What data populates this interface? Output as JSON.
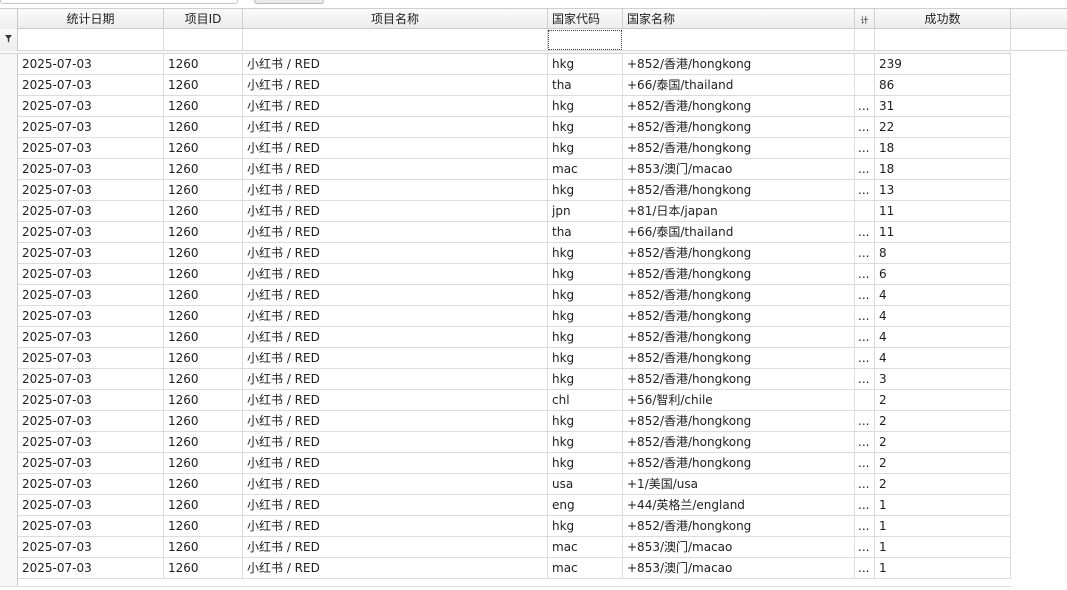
{
  "columns": [
    {
      "key": "date",
      "label": "统计日期"
    },
    {
      "key": "project_id",
      "label": "项目ID"
    },
    {
      "key": "project_name",
      "label": "项目名称"
    },
    {
      "key": "country_code",
      "label": "国家代码"
    },
    {
      "key": "country_name",
      "label": "国家名称"
    },
    {
      "key": "extra",
      "label": "计"
    },
    {
      "key": "success_count",
      "label": "成功数"
    }
  ],
  "filter_icon": "filter-funnel-icon",
  "rows": [
    {
      "date": "2025-07-03",
      "project_id": "1260",
      "project_name": "小红书 / RED",
      "country_code": "hkg",
      "country_name": "+852/香港/hongkong",
      "extra": "",
      "success_count": "239"
    },
    {
      "date": "2025-07-03",
      "project_id": "1260",
      "project_name": "小红书 / RED",
      "country_code": "tha",
      "country_name": "+66/泰国/thailand",
      "extra": "",
      "success_count": "86"
    },
    {
      "date": "2025-07-03",
      "project_id": "1260",
      "project_name": "小红书 / RED",
      "country_code": "hkg",
      "country_name": "+852/香港/hongkong",
      "extra": "...",
      "success_count": "31"
    },
    {
      "date": "2025-07-03",
      "project_id": "1260",
      "project_name": "小红书 / RED",
      "country_code": "hkg",
      "country_name": "+852/香港/hongkong",
      "extra": "...",
      "success_count": "22"
    },
    {
      "date": "2025-07-03",
      "project_id": "1260",
      "project_name": "小红书 / RED",
      "country_code": "hkg",
      "country_name": "+852/香港/hongkong",
      "extra": "...",
      "success_count": "18"
    },
    {
      "date": "2025-07-03",
      "project_id": "1260",
      "project_name": "小红书 / RED",
      "country_code": "mac",
      "country_name": "+853/澳门/macao",
      "extra": "...",
      "success_count": "18"
    },
    {
      "date": "2025-07-03",
      "project_id": "1260",
      "project_name": "小红书 / RED",
      "country_code": "hkg",
      "country_name": "+852/香港/hongkong",
      "extra": "...",
      "success_count": "13"
    },
    {
      "date": "2025-07-03",
      "project_id": "1260",
      "project_name": "小红书 / RED",
      "country_code": "jpn",
      "country_name": "+81/日本/japan",
      "extra": "",
      "success_count": "11"
    },
    {
      "date": "2025-07-03",
      "project_id": "1260",
      "project_name": "小红书 / RED",
      "country_code": "tha",
      "country_name": "+66/泰国/thailand",
      "extra": "...",
      "success_count": "11"
    },
    {
      "date": "2025-07-03",
      "project_id": "1260",
      "project_name": "小红书 / RED",
      "country_code": "hkg",
      "country_name": "+852/香港/hongkong",
      "extra": "...",
      "success_count": "8"
    },
    {
      "date": "2025-07-03",
      "project_id": "1260",
      "project_name": "小红书 / RED",
      "country_code": "hkg",
      "country_name": "+852/香港/hongkong",
      "extra": "...",
      "success_count": "6"
    },
    {
      "date": "2025-07-03",
      "project_id": "1260",
      "project_name": "小红书 / RED",
      "country_code": "hkg",
      "country_name": "+852/香港/hongkong",
      "extra": "...",
      "success_count": "4"
    },
    {
      "date": "2025-07-03",
      "project_id": "1260",
      "project_name": "小红书 / RED",
      "country_code": "hkg",
      "country_name": "+852/香港/hongkong",
      "extra": "...",
      "success_count": "4"
    },
    {
      "date": "2025-07-03",
      "project_id": "1260",
      "project_name": "小红书 / RED",
      "country_code": "hkg",
      "country_name": "+852/香港/hongkong",
      "extra": "...",
      "success_count": "4"
    },
    {
      "date": "2025-07-03",
      "project_id": "1260",
      "project_name": "小红书 / RED",
      "country_code": "hkg",
      "country_name": "+852/香港/hongkong",
      "extra": "...",
      "success_count": "4"
    },
    {
      "date": "2025-07-03",
      "project_id": "1260",
      "project_name": "小红书 / RED",
      "country_code": "hkg",
      "country_name": "+852/香港/hongkong",
      "extra": "...",
      "success_count": "3"
    },
    {
      "date": "2025-07-03",
      "project_id": "1260",
      "project_name": "小红书 / RED",
      "country_code": "chl",
      "country_name": "+56/智利/chile",
      "extra": "",
      "success_count": "2"
    },
    {
      "date": "2025-07-03",
      "project_id": "1260",
      "project_name": "小红书 / RED",
      "country_code": "hkg",
      "country_name": "+852/香港/hongkong",
      "extra": "...",
      "success_count": "2"
    },
    {
      "date": "2025-07-03",
      "project_id": "1260",
      "project_name": "小红书 / RED",
      "country_code": "hkg",
      "country_name": "+852/香港/hongkong",
      "extra": "...",
      "success_count": "2"
    },
    {
      "date": "2025-07-03",
      "project_id": "1260",
      "project_name": "小红书 / RED",
      "country_code": "hkg",
      "country_name": "+852/香港/hongkong",
      "extra": "...",
      "success_count": "2"
    },
    {
      "date": "2025-07-03",
      "project_id": "1260",
      "project_name": "小红书 / RED",
      "country_code": "usa",
      "country_name": "+1/美国/usa",
      "extra": "...",
      "success_count": "2"
    },
    {
      "date": "2025-07-03",
      "project_id": "1260",
      "project_name": "小红书 / RED",
      "country_code": "eng",
      "country_name": "+44/英格兰/england",
      "extra": "...",
      "success_count": "1"
    },
    {
      "date": "2025-07-03",
      "project_id": "1260",
      "project_name": "小红书 / RED",
      "country_code": "hkg",
      "country_name": "+852/香港/hongkong",
      "extra": "...",
      "success_count": "1"
    },
    {
      "date": "2025-07-03",
      "project_id": "1260",
      "project_name": "小红书 / RED",
      "country_code": "mac",
      "country_name": "+853/澳门/macao",
      "extra": "...",
      "success_count": "1"
    },
    {
      "date": "2025-07-03",
      "project_id": "1260",
      "project_name": "小红书 / RED",
      "country_code": "mac",
      "country_name": "+853/澳门/macao",
      "extra": "...",
      "success_count": "1"
    }
  ]
}
